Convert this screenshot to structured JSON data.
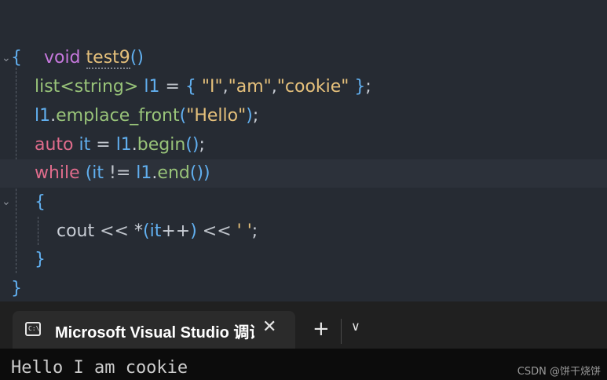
{
  "editor": {
    "l1": {
      "void": "void",
      "fn": "test9",
      "parens": "()"
    },
    "l2": {
      "brace": "{"
    },
    "l3": {
      "type": "list<string>",
      "var": "l1",
      "eq": " = ",
      "open": "{ ",
      "s1": "\"I\"",
      "c1": ",",
      "s2": "\"am\"",
      "c2": ",",
      "s3": "\"cookie\"",
      "close": " }",
      "semi": ";"
    },
    "l4": {
      "var": "l1",
      "dot": ".",
      "method": "emplace_front",
      "open": "(",
      "str": "\"Hello\"",
      "close": ")",
      "semi": ";"
    },
    "l5": {
      "kw": "auto",
      "var": "it",
      "eq": " = ",
      "obj": "l1",
      "dot": ".",
      "method": "begin",
      "parens": "()",
      "semi": ";"
    },
    "l6": {
      "kw": "while",
      "open": "(",
      "var": "it",
      "op": " != ",
      "obj": "l1",
      "dot": ".",
      "method": "end",
      "parens": "())"
    },
    "l7": {
      "brace": "{"
    },
    "l8": {
      "cout": "cout",
      "op1": " << ",
      "star": "*",
      "open": "(",
      "var": "it",
      "inc": "++",
      "close": ")",
      "op2": " << ",
      "str": "' '",
      "semi": ";"
    },
    "l9": {
      "brace": "}"
    },
    "l10": {
      "brace": "}"
    }
  },
  "terminal": {
    "tab_title": "Microsoft Visual Studio 调试控制台",
    "close_glyph": "✕",
    "new_tab_glyph": "+",
    "dropdown_glyph": "∨",
    "icon_label": "C:\\",
    "output": "Hello I am cookie"
  },
  "watermark": "CSDN @饼干烧饼"
}
